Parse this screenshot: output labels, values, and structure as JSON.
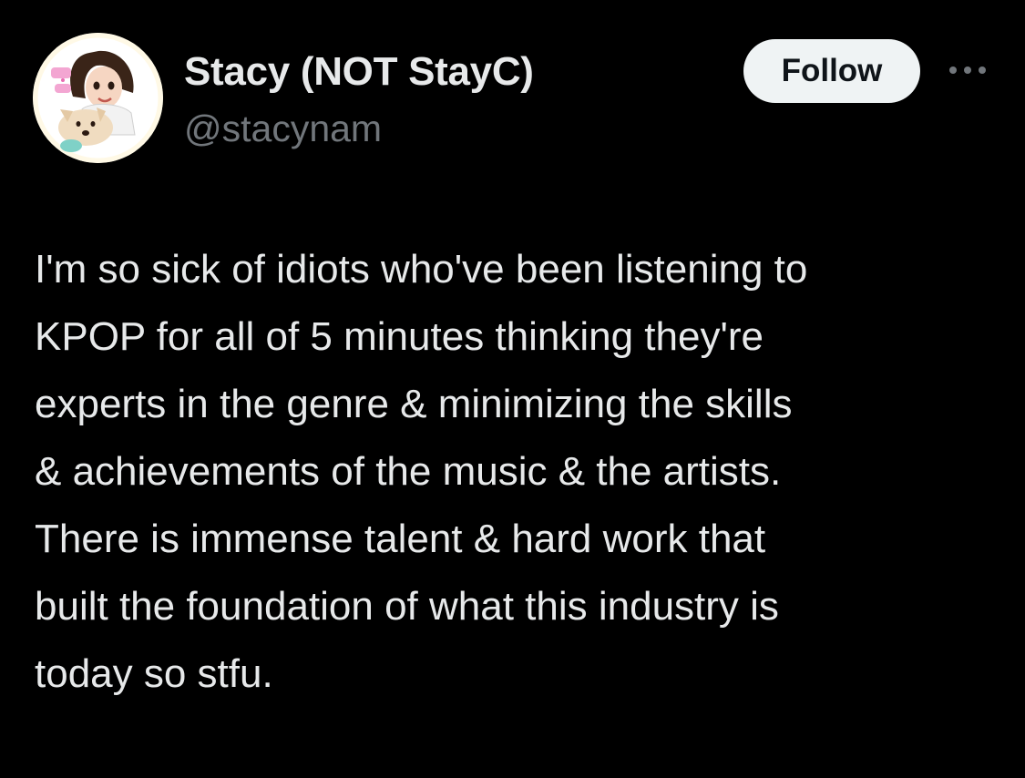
{
  "author": {
    "display_name": "Stacy (NOT StayC)",
    "handle": "@stacynam",
    "avatar_icon": "profile-avatar-illustration"
  },
  "actions": {
    "follow_label": "Follow",
    "more_icon": "more-horizontal-icon"
  },
  "tweet": {
    "lines": [
      "I'm so sick of idiots who've been listening to",
      "KPOP for all of 5 minutes thinking they're",
      "experts in the genre & minimizing the skills",
      "& achievements of the music & the artists.",
      "There is immense talent & hard work that",
      "built the foundation of what this industry is",
      "today so stfu."
    ]
  },
  "colors": {
    "background": "#000000",
    "primary_text": "#e7e9ea",
    "secondary_text": "#71767b",
    "follow_bg": "#eff3f4",
    "follow_text": "#0f1419"
  }
}
